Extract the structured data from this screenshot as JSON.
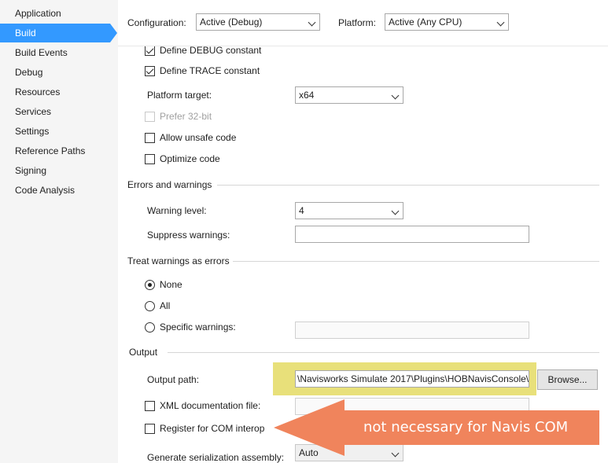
{
  "sidebar": {
    "items": [
      {
        "label": "Application"
      },
      {
        "label": "Build"
      },
      {
        "label": "Build Events"
      },
      {
        "label": "Debug"
      },
      {
        "label": "Resources"
      },
      {
        "label": "Services"
      },
      {
        "label": "Settings"
      },
      {
        "label": "Reference Paths"
      },
      {
        "label": "Signing"
      },
      {
        "label": "Code Analysis"
      }
    ],
    "active": "Build"
  },
  "header": {
    "configuration_label": "Configuration:",
    "configuration_value": "Active (Debug)",
    "platform_label": "Platform:",
    "platform_value": "Active (Any CPU)"
  },
  "general": {
    "define_debug_label": "Define DEBUG constant",
    "define_debug_checked": true,
    "define_trace_label": "Define TRACE constant",
    "define_trace_checked": true,
    "platform_target_label": "Platform target:",
    "platform_target_value": "x64",
    "prefer32_label": "Prefer 32-bit",
    "allow_unsafe_label": "Allow unsafe code",
    "optimize_label": "Optimize code"
  },
  "errors": {
    "section_title": "Errors and warnings",
    "warning_level_label": "Warning level:",
    "warning_level_value": "4",
    "suppress_label": "Suppress warnings:",
    "suppress_value": ""
  },
  "treat_warnings": {
    "section_title": "Treat warnings as errors",
    "none_label": "None",
    "all_label": "All",
    "specific_label": "Specific warnings:",
    "selected": "None"
  },
  "output": {
    "section_title": "Output",
    "path_label": "Output path:",
    "path_value": "\\Navisworks Simulate 2017\\Plugins\\HOBNavisConsole\\",
    "browse_label": "Browse...",
    "xml_doc_label": "XML documentation file:",
    "com_interop_label": "Register for COM interop",
    "serialization_label": "Generate serialization assembly:",
    "serialization_value": "Auto"
  },
  "annotation": {
    "callout_text": "not necessary for Navis COM",
    "callout_color": "#f0845c",
    "highlight_color": "#e8e07a"
  },
  "colors": {
    "accent": "#3399ff"
  }
}
